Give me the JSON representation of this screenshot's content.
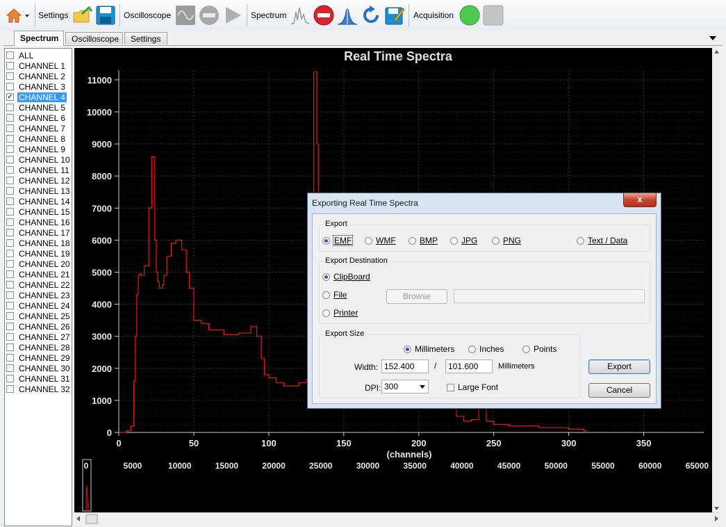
{
  "toolbar": {
    "settings_label": "Settings",
    "oscilloscope_label": "Oscilloscope",
    "spectrum_label": "Spectrum",
    "acquisition_label": "Acquisition",
    "acquisition_status_color": "#4ecb4e"
  },
  "tabs": [
    {
      "label": "Spectrum",
      "active": true
    },
    {
      "label": "Oscilloscope",
      "active": false
    },
    {
      "label": "Settings",
      "active": false
    }
  ],
  "channels": [
    {
      "label": "ALL",
      "checked": false
    },
    {
      "label": "CHANNEL 1",
      "checked": false
    },
    {
      "label": "CHANNEL 2",
      "checked": false
    },
    {
      "label": "CHANNEL 3",
      "checked": false
    },
    {
      "label": "CHANNEL 4",
      "checked": true
    },
    {
      "label": "CHANNEL 5",
      "checked": false
    },
    {
      "label": "CHANNEL 6",
      "checked": false
    },
    {
      "label": "CHANNEL 7",
      "checked": false
    },
    {
      "label": "CHANNEL 8",
      "checked": false
    },
    {
      "label": "CHANNEL 9",
      "checked": false
    },
    {
      "label": "CHANNEL 10",
      "checked": false
    },
    {
      "label": "CHANNEL 11",
      "checked": false
    },
    {
      "label": "CHANNEL 12",
      "checked": false
    },
    {
      "label": "CHANNEL 13",
      "checked": false
    },
    {
      "label": "CHANNEL 14",
      "checked": false
    },
    {
      "label": "CHANNEL 15",
      "checked": false
    },
    {
      "label": "CHANNEL 16",
      "checked": false
    },
    {
      "label": "CHANNEL 17",
      "checked": false
    },
    {
      "label": "CHANNEL 18",
      "checked": false
    },
    {
      "label": "CHANNEL 19",
      "checked": false
    },
    {
      "label": "CHANNEL 20",
      "checked": false
    },
    {
      "label": "CHANNEL 21",
      "checked": false
    },
    {
      "label": "CHANNEL 22",
      "checked": false
    },
    {
      "label": "CHANNEL 23",
      "checked": false
    },
    {
      "label": "CHANNEL 24",
      "checked": false
    },
    {
      "label": "CHANNEL 25",
      "checked": false
    },
    {
      "label": "CHANNEL 26",
      "checked": false
    },
    {
      "label": "CHANNEL 27",
      "checked": false
    },
    {
      "label": "CHANNEL 28",
      "checked": false
    },
    {
      "label": "CHANNEL 29",
      "checked": false
    },
    {
      "label": "CHANNEL 30",
      "checked": false
    },
    {
      "label": "CHANNEL 31",
      "checked": false
    },
    {
      "label": "CHANNEL 32",
      "checked": false
    }
  ],
  "chart_data": {
    "type": "line",
    "title": "Real Time Spectra",
    "xlabel": "(channels)",
    "ylabel": "",
    "xlim": [
      0,
      390
    ],
    "ylim": [
      0,
      11300
    ],
    "x_ticks": [
      0,
      50,
      100,
      150,
      200,
      250,
      300,
      350
    ],
    "y_ticks": [
      0,
      1000,
      2000,
      3000,
      4000,
      5000,
      6000,
      7000,
      8000,
      9000,
      10000,
      11000
    ],
    "grid": true,
    "line_color": "#e8191e",
    "series": [
      {
        "x": [
          0,
          5,
          8,
          10,
          11,
          12,
          13,
          14,
          15,
          17,
          20,
          22,
          24,
          25,
          26,
          27,
          29,
          30,
          32,
          35,
          38,
          42,
          45,
          47,
          50,
          55,
          60,
          70,
          80,
          88,
          92,
          95,
          97,
          100,
          105,
          110,
          115,
          120,
          125,
          128,
          130,
          131,
          132,
          133,
          134,
          135,
          136,
          140,
          145,
          150,
          155,
          160,
          170,
          190,
          210,
          222,
          225,
          230,
          235,
          240,
          242,
          245,
          250,
          260,
          280,
          300,
          310,
          311
        ],
        "y": [
          0,
          50,
          200,
          1600,
          3000,
          4300,
          4900,
          4950,
          4900,
          5200,
          7000,
          8600,
          6000,
          5000,
          4700,
          4500,
          4600,
          4900,
          5500,
          5900,
          6000,
          5700,
          5000,
          4500,
          3500,
          3400,
          3200,
          3050,
          3100,
          3300,
          3000,
          2300,
          1800,
          1700,
          1550,
          1450,
          1450,
          1550,
          1650,
          1900,
          11250,
          11250,
          9000,
          5000,
          2800,
          2400,
          2200,
          2100,
          2050,
          2000,
          1950,
          1900,
          1800,
          1700,
          1400,
          1100,
          500,
          350,
          400,
          900,
          1300,
          350,
          250,
          200,
          150,
          100,
          60,
          0
        ]
      }
    ],
    "overview_ticks": [
      "0",
      "5000",
      "10000",
      "15000",
      "20000",
      "25000",
      "30000",
      "35000",
      "40000",
      "45000",
      "50000",
      "55000",
      "60000",
      "65000"
    ]
  },
  "dialog": {
    "title": "Exporting Real Time Spectra",
    "close_glyph": "x",
    "export_group": "Export",
    "formats": [
      {
        "label": "EMF",
        "selected": true
      },
      {
        "label": "WMF",
        "selected": false
      },
      {
        "label": "BMP",
        "selected": false
      },
      {
        "label": "JPG",
        "selected": false
      },
      {
        "label": "PNG",
        "selected": false
      },
      {
        "label": "Text / Data",
        "selected": false
      }
    ],
    "destination_group": "Export Destination",
    "destinations": [
      {
        "label": "ClipBoard",
        "selected": true
      },
      {
        "label": "File",
        "selected": false
      },
      {
        "label": "Printer",
        "selected": false
      }
    ],
    "browse_label": "Browse",
    "file_path": "",
    "size_group": "Export Size",
    "units": [
      {
        "label": "Millimeters",
        "selected": true
      },
      {
        "label": "Inches",
        "selected": false
      },
      {
        "label": "Points",
        "selected": false
      }
    ],
    "width_label": "Width:",
    "width_value": "152.400",
    "separator": "/",
    "height_value": "101.600",
    "unit_suffix": "Millimeters",
    "dpi_label": "DPI:",
    "dpi_value": "300",
    "large_font_label": "Large Font",
    "large_font_checked": false,
    "export_button": "Export",
    "cancel_button": "Cancel"
  }
}
